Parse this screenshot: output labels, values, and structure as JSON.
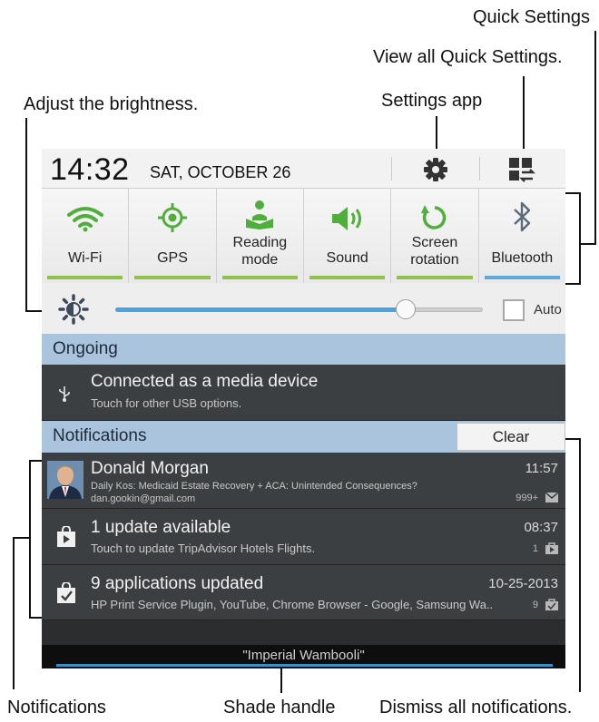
{
  "callouts": {
    "quick_settings": "Quick Settings",
    "view_all": "View all Quick Settings.",
    "settings_app": "Settings app",
    "brightness": "Adjust the brightness.",
    "notifications": "Notifications",
    "shade_handle": "Shade handle",
    "dismiss_all": "Dismiss all notifications."
  },
  "status": {
    "time": "14:32",
    "date": "SAT, OCTOBER 26"
  },
  "header_icons": {
    "settings": "gear-icon",
    "quick_settings": "quick-settings-grid-icon"
  },
  "tiles": [
    {
      "label": "Wi-Fi",
      "icon": "wifi-icon",
      "active": true
    },
    {
      "label": "GPS",
      "icon": "gps-icon",
      "active": true
    },
    {
      "label": "Reading mode",
      "icon": "reading-mode-icon",
      "active": true
    },
    {
      "label": "Sound",
      "icon": "sound-icon",
      "active": true
    },
    {
      "label": "Screen rotation",
      "icon": "rotation-icon",
      "active": true
    },
    {
      "label": "Bluetooth",
      "icon": "bluetooth-icon",
      "active": false
    }
  ],
  "brightness": {
    "level": 0.79,
    "auto_label": "Auto",
    "auto_checked": false
  },
  "ongoing": {
    "section_title": "Ongoing",
    "title": "Connected as a media device",
    "subtitle": "Touch for other USB options."
  },
  "notifications": {
    "section_title": "Notifications",
    "clear_label": "Clear",
    "items": [
      {
        "title": "Donald Morgan",
        "line1": "Daily Kos: Medicaid Estate Recovery + ACA: Unintended Consequences?",
        "line2": "dan.gookin@gmail.com",
        "time": "11:57",
        "count": "999+"
      },
      {
        "title": "1 update available",
        "line1": "Touch to update TripAdvisor Hotels Flights.",
        "time": "08:37",
        "count": "1"
      },
      {
        "title": "9 applications updated",
        "line1": "HP Print Service Plugin, YouTube, Chrome Browser - Google, Samsung Wa..",
        "time": "10-25-2013",
        "count": "9"
      }
    ]
  },
  "shade": {
    "carrier": "\"Imperial Wambooli\""
  },
  "colors": {
    "active_bar": "#8fc24a",
    "bluetooth_bar": "#5fa8d9",
    "section_bar": "#a9c4dc",
    "slider_fill": "#4aa3df"
  }
}
